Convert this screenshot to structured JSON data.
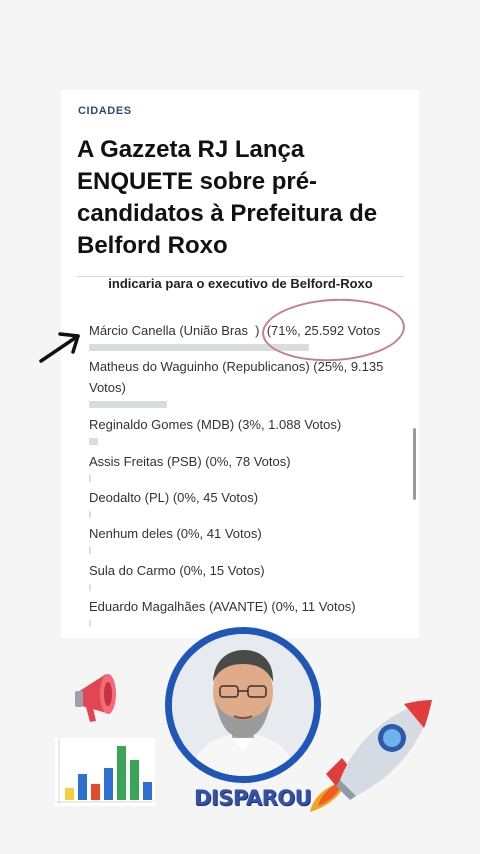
{
  "article": {
    "category": "CIDADES",
    "headline": "A Gazzeta RJ Lança ENQUETE sobre pré-candidatos à Prefeitura de Belford Roxo"
  },
  "poll": {
    "question": "indicaria para o executivo de Belford-Roxo",
    "options": [
      {
        "label": "Márcio Canella (União Bras  )  (71%, 25.592 Votos",
        "percent": 71
      },
      {
        "label": "Matheus do Waguinho (Republicanos) (25%, 9.135 Votos)",
        "percent": 25
      },
      {
        "label": "Reginaldo Gomes (MDB) (3%, 1.088 Votos)",
        "percent": 3
      },
      {
        "label": "Assis Freitas (PSB) (0%, 78 Votos)",
        "percent": 0
      },
      {
        "label": "Deodalto (PL) (0%, 45 Votos)",
        "percent": 0
      },
      {
        "label": "Nenhum deles (0%, 41 Votos)",
        "percent": 0
      },
      {
        "label": "Sula do Carmo (0%, 15 Votos)",
        "percent": 0
      },
      {
        "label": "Eduardo Magalhães (AVANTE) (0%, 11 Votos)",
        "percent": 0
      }
    ]
  },
  "overlay": {
    "sticker_text": "DISPAROU",
    "icons": [
      "arrow-icon",
      "megaphone-icon",
      "bar-chart-icon",
      "rocket-icon"
    ],
    "colors": {
      "circle": "#c87f86",
      "ring": "#1f56b8",
      "sticker": "#3251a8"
    }
  }
}
